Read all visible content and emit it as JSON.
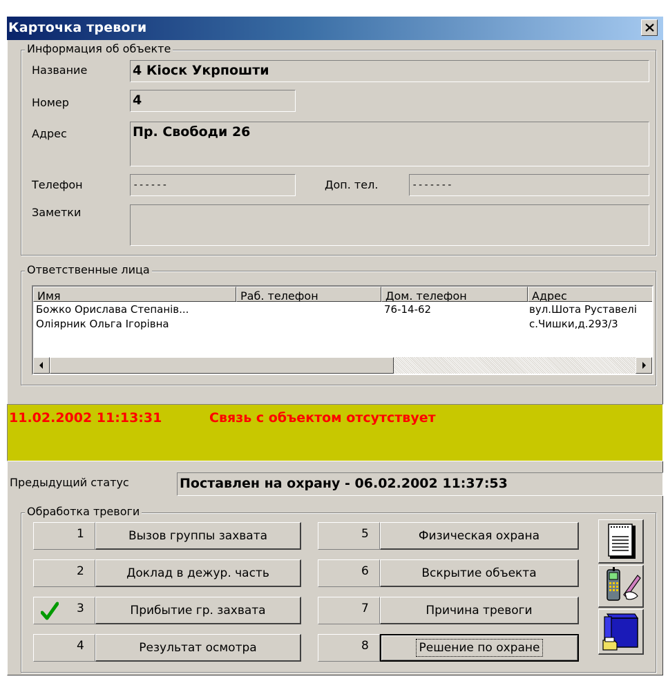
{
  "window": {
    "title": "Карточка тревоги"
  },
  "object_info": {
    "legend": "Информация об объекте",
    "name_label": "Название",
    "name_value": "4 Кіоск  Укрпошти",
    "number_label": "Номер",
    "number_value": "4",
    "address_label": "Адрес",
    "address_value": "Пр. Свободи 26",
    "phone_label": "Телефон",
    "phone_value": "------",
    "extra_phone_label": "Доп. тел.",
    "extra_phone_value": "-------",
    "notes_label": "Заметки",
    "notes_value": ""
  },
  "responsible": {
    "legend": "Ответственные лица",
    "columns": [
      "Имя",
      "Раб. телефон",
      "Дом. телефон",
      "Адрес"
    ],
    "rows": [
      [
        "Божко Орислава Степанів...",
        "",
        "76-14-62",
        "вул.Шота Руставелі"
      ],
      [
        "Оліярник Ольга Ігорівна",
        "",
        "",
        "с.Чишки,д.293/3"
      ]
    ]
  },
  "alarm": {
    "time": "11.02.2002 11:13:31",
    "message": "Связь с объектом отсутствует",
    "bg_color": "#c8c800",
    "text_color": "#ff0000"
  },
  "previous_status": {
    "label": "Предыдущий статус",
    "value": "Поставлен на охрану - 06.02.2002 11:37:53"
  },
  "processing": {
    "legend": "Обработка тревоги",
    "steps": [
      {
        "num": "1",
        "label": "Вызов группы захвата",
        "checked": false
      },
      {
        "num": "2",
        "label": "Доклад в дежур. часть",
        "checked": false
      },
      {
        "num": "3",
        "label": "Прибытие гр. захвата",
        "checked": true
      },
      {
        "num": "4",
        "label": "Результат осмотра",
        "checked": false
      },
      {
        "num": "5",
        "label": "Физическая охрана",
        "checked": false
      },
      {
        "num": "6",
        "label": "Вскрытие объекта",
        "checked": false
      },
      {
        "num": "7",
        "label": "Причина тревоги",
        "checked": false
      },
      {
        "num": "8",
        "label": "Решение по охране",
        "checked": false
      }
    ],
    "icons": [
      "notepad-icon",
      "phone-note-icon",
      "archive-box-icon"
    ]
  }
}
